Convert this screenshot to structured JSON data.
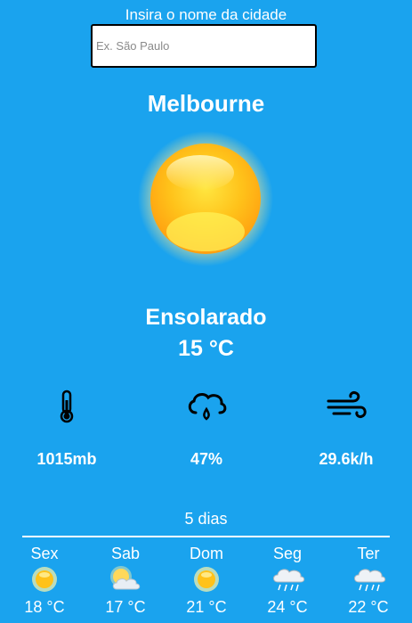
{
  "search": {
    "label": "Insira o nome da cidade",
    "placeholder": "Ex. São Paulo",
    "value": ""
  },
  "current": {
    "city": "Melbourne",
    "icon": "sun-icon",
    "condition": "Ensolarado",
    "temperature": "15 °C"
  },
  "stats": {
    "pressure": {
      "icon": "thermometer-icon",
      "value": "1015mb"
    },
    "humidity": {
      "icon": "rain-cloud-icon",
      "value": "47%"
    },
    "wind": {
      "icon": "wind-icon",
      "value": "29.6k/h"
    }
  },
  "forecast": {
    "title": "5 dias",
    "days": [
      {
        "name": "Sex",
        "icon": "sun-icon",
        "temp": "18 °C"
      },
      {
        "name": "Sab",
        "icon": "partly-cloudy-icon",
        "temp": "17 °C"
      },
      {
        "name": "Dom",
        "icon": "sun-icon",
        "temp": "21 °C"
      },
      {
        "name": "Seg",
        "icon": "rain-cloud-icon",
        "temp": "24 °C"
      },
      {
        "name": "Ter",
        "icon": "rain-cloud-icon",
        "temp": "22 °C"
      }
    ]
  },
  "colors": {
    "background": "#1aa3ee",
    "text": "#ffffff",
    "sun_core": "#ffd21a",
    "sun_glow": "#fff3a0"
  }
}
